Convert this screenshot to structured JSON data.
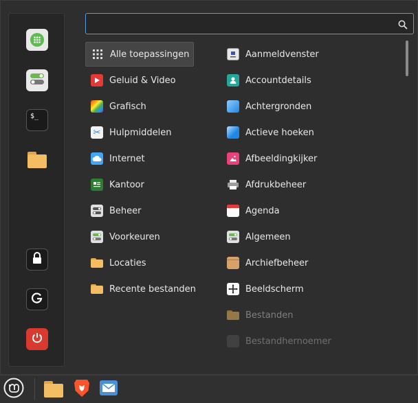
{
  "search": {
    "placeholder": "",
    "value": ""
  },
  "favorites": [
    {
      "name": "apps-grid",
      "icon": "grid-icon"
    },
    {
      "name": "settings-toggle",
      "icon": "toggle-icon"
    },
    {
      "name": "terminal",
      "icon": "terminal-icon"
    },
    {
      "name": "files",
      "icon": "folder-icon"
    },
    {
      "name": "lock-screen",
      "icon": "lock-icon"
    },
    {
      "name": "logout",
      "icon": "logout-icon"
    },
    {
      "name": "shutdown",
      "icon": "power-icon"
    }
  ],
  "categories": [
    {
      "label": "Alle toepassingen",
      "icon": "grid-icon"
    },
    {
      "label": "Geluid & Video",
      "icon": "play-icon"
    },
    {
      "label": "Grafisch",
      "icon": "palette-icon"
    },
    {
      "label": "Hulpmiddelen",
      "icon": "scissors-icon"
    },
    {
      "label": "Internet",
      "icon": "cloud-icon"
    },
    {
      "label": "Kantoor",
      "icon": "office-icon"
    },
    {
      "label": "Beheer",
      "icon": "admin-icon"
    },
    {
      "label": "Voorkeuren",
      "icon": "toggle-icon"
    },
    {
      "label": "Locaties",
      "icon": "folder-icon"
    },
    {
      "label": "Recente bestanden",
      "icon": "recent-folder-icon"
    }
  ],
  "apps": [
    {
      "label": "Aanmeldvenster",
      "icon": "login-window-icon"
    },
    {
      "label": "Accountdetails",
      "icon": "account-icon"
    },
    {
      "label": "Achtergronden",
      "icon": "wallpaper-icon"
    },
    {
      "label": "Actieve hoeken",
      "icon": "hot-corners-icon"
    },
    {
      "label": "Afbeeldingkijker",
      "icon": "image-viewer-icon"
    },
    {
      "label": "Afdrukbeheer",
      "icon": "printer-icon"
    },
    {
      "label": "Agenda",
      "icon": "calendar-icon"
    },
    {
      "label": "Algemeen",
      "icon": "toggle-icon"
    },
    {
      "label": "Archiefbeheer",
      "icon": "archive-icon"
    },
    {
      "label": "Beeldscherm",
      "icon": "display-icon"
    },
    {
      "label": "Bestanden",
      "icon": "folder-icon"
    },
    {
      "label": "Bestandhernoemer",
      "icon": "renamer-icon"
    }
  ],
  "taskbar": [
    {
      "name": "menu",
      "icon": "mint-logo-icon"
    },
    {
      "name": "files",
      "icon": "folder-icon"
    },
    {
      "name": "brave",
      "icon": "brave-lion-icon"
    },
    {
      "name": "mail",
      "icon": "mail-icon"
    }
  ]
}
